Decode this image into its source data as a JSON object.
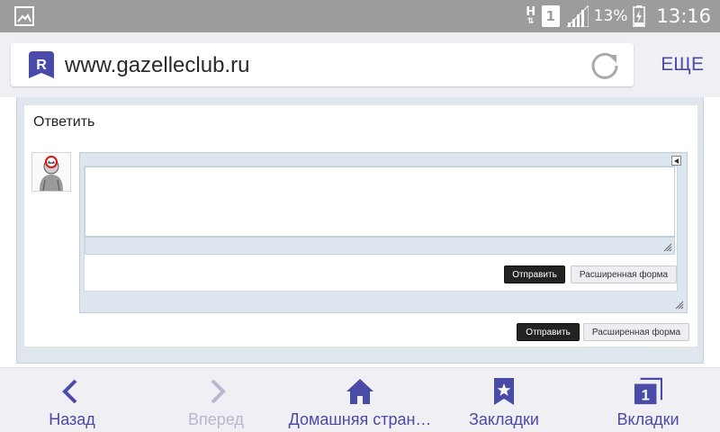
{
  "status_bar": {
    "network": "H",
    "sim": "1",
    "battery_percent": "13%",
    "time": "13:16"
  },
  "browser": {
    "url": "www.gazelleclub.ru",
    "more_label": "ЕЩЕ",
    "logo_letter": "R"
  },
  "reply": {
    "title": "Ответить",
    "inner_submit": "Отправить",
    "inner_advanced": "Расширенная форма",
    "outer_submit": "Отправить",
    "outer_advanced": "Расширенная форма"
  },
  "bottom_nav": {
    "back": "Назад",
    "forward": "Вперед",
    "home": "Домашняя стран…",
    "bookmarks": "Закладки",
    "tabs": "Вкладки",
    "tabs_count": "1"
  },
  "colors": {
    "accent": "#4a4aa8",
    "statusbar": "#9c9c9c",
    "panel": "#dfe6ee"
  }
}
